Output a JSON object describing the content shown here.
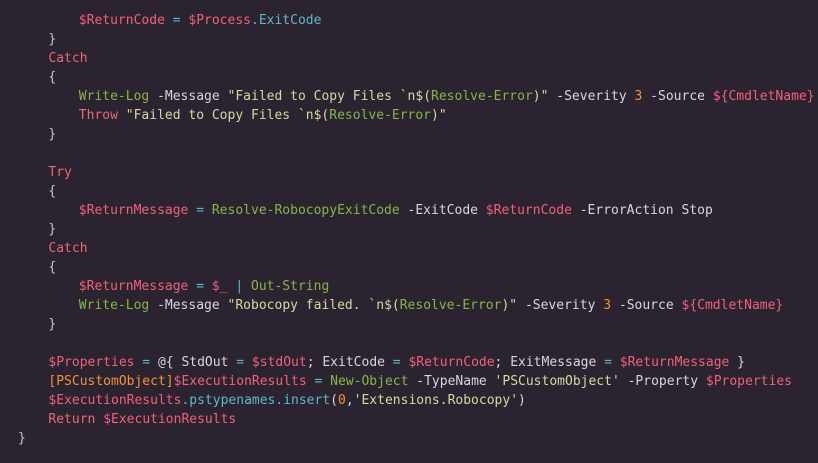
{
  "editor": {
    "language": "PowerShell",
    "colors": {
      "background": "#2b2430",
      "keyword": "#e86873",
      "variable": "#f0607a",
      "operator": "#5fb7c7",
      "command": "#86b44a",
      "string": "#d6d7a2",
      "number": "#f0933c",
      "text": "#d9d4dd"
    },
    "lines": [
      {
        "indent": 8,
        "tokens": [
          {
            "t": "var",
            "v": "$ReturnCode"
          },
          {
            "t": "op",
            "v": " = "
          },
          {
            "t": "var",
            "v": "$Process"
          },
          {
            "t": "prop",
            "v": ".ExitCode"
          }
        ]
      },
      {
        "indent": 4,
        "tokens": [
          {
            "t": "punc",
            "v": "}"
          }
        ]
      },
      {
        "indent": 4,
        "tokens": [
          {
            "t": "kw",
            "v": "Catch"
          }
        ]
      },
      {
        "indent": 4,
        "tokens": [
          {
            "t": "punc",
            "v": "{"
          }
        ]
      },
      {
        "indent": 8,
        "tokens": [
          {
            "t": "cmd",
            "v": "Write-Log"
          },
          {
            "t": "plain",
            "v": " -Message "
          },
          {
            "t": "str",
            "v": "\"Failed to Copy Files `n$("
          },
          {
            "t": "cmd",
            "v": "Resolve-Error"
          },
          {
            "t": "str",
            "v": ")\""
          },
          {
            "t": "plain",
            "v": " -Severity "
          },
          {
            "t": "num",
            "v": "3"
          },
          {
            "t": "plain",
            "v": " -Source "
          },
          {
            "t": "var",
            "v": "${CmdletName}"
          }
        ]
      },
      {
        "indent": 8,
        "tokens": [
          {
            "t": "kw",
            "v": "Throw"
          },
          {
            "t": "str",
            "v": " \"Failed to Copy Files `n$("
          },
          {
            "t": "cmd",
            "v": "Resolve-Error"
          },
          {
            "t": "str",
            "v": ")\""
          }
        ]
      },
      {
        "indent": 4,
        "tokens": [
          {
            "t": "punc",
            "v": "}"
          }
        ]
      },
      {
        "indent": 0,
        "tokens": []
      },
      {
        "indent": 4,
        "tokens": [
          {
            "t": "kw",
            "v": "Try"
          }
        ]
      },
      {
        "indent": 4,
        "tokens": [
          {
            "t": "punc",
            "v": "{"
          }
        ]
      },
      {
        "indent": 8,
        "tokens": [
          {
            "t": "var",
            "v": "$ReturnMessage"
          },
          {
            "t": "op",
            "v": " = "
          },
          {
            "t": "cmd",
            "v": "Resolve-RobocopyExitCode"
          },
          {
            "t": "plain",
            "v": " -ExitCode "
          },
          {
            "t": "var",
            "v": "$ReturnCode"
          },
          {
            "t": "plain",
            "v": " -ErrorAction Stop"
          }
        ]
      },
      {
        "indent": 4,
        "tokens": [
          {
            "t": "punc",
            "v": "}"
          }
        ]
      },
      {
        "indent": 4,
        "tokens": [
          {
            "t": "kw",
            "v": "Catch"
          }
        ]
      },
      {
        "indent": 4,
        "tokens": [
          {
            "t": "punc",
            "v": "{"
          }
        ]
      },
      {
        "indent": 8,
        "tokens": [
          {
            "t": "var",
            "v": "$ReturnMessage"
          },
          {
            "t": "op",
            "v": " = "
          },
          {
            "t": "var",
            "v": "$_"
          },
          {
            "t": "op",
            "v": " | "
          },
          {
            "t": "cmd",
            "v": "Out-String"
          }
        ]
      },
      {
        "indent": 8,
        "tokens": [
          {
            "t": "cmd",
            "v": "Write-Log"
          },
          {
            "t": "plain",
            "v": " -Message "
          },
          {
            "t": "str",
            "v": "\"Robocopy failed. `n$("
          },
          {
            "t": "cmd",
            "v": "Resolve-Error"
          },
          {
            "t": "str",
            "v": ")\""
          },
          {
            "t": "plain",
            "v": " -Severity "
          },
          {
            "t": "num",
            "v": "3"
          },
          {
            "t": "plain",
            "v": " -Source "
          },
          {
            "t": "var",
            "v": "${CmdletName}"
          }
        ]
      },
      {
        "indent": 4,
        "tokens": [
          {
            "t": "punc",
            "v": "}"
          }
        ]
      },
      {
        "indent": 0,
        "tokens": []
      },
      {
        "indent": 4,
        "tokens": [
          {
            "t": "var",
            "v": "$Properties"
          },
          {
            "t": "op",
            "v": " = "
          },
          {
            "t": "plain",
            "v": "@{ StdOut "
          },
          {
            "t": "op",
            "v": "= "
          },
          {
            "t": "var",
            "v": "$stdOut"
          },
          {
            "t": "plain",
            "v": "; ExitCode "
          },
          {
            "t": "op",
            "v": "= "
          },
          {
            "t": "var",
            "v": "$ReturnCode"
          },
          {
            "t": "plain",
            "v": "; ExitMessage "
          },
          {
            "t": "op",
            "v": "= "
          },
          {
            "t": "var",
            "v": "$ReturnMessage"
          },
          {
            "t": "plain",
            "v": " }"
          }
        ]
      },
      {
        "indent": 4,
        "tokens": [
          {
            "t": "type",
            "v": "[PSCustomObject]"
          },
          {
            "t": "var",
            "v": "$ExecutionResults"
          },
          {
            "t": "op",
            "v": " = "
          },
          {
            "t": "cmd",
            "v": "New-Object"
          },
          {
            "t": "plain",
            "v": " -TypeName "
          },
          {
            "t": "str",
            "v": "'PSCustomObject'"
          },
          {
            "t": "plain",
            "v": " -Property "
          },
          {
            "t": "var",
            "v": "$Properties"
          }
        ]
      },
      {
        "indent": 4,
        "tokens": [
          {
            "t": "var",
            "v": "$ExecutionResults"
          },
          {
            "t": "prop",
            "v": ".pstypenames.insert"
          },
          {
            "t": "plain",
            "v": "("
          },
          {
            "t": "num",
            "v": "0"
          },
          {
            "t": "plain",
            "v": ","
          },
          {
            "t": "str",
            "v": "'Extensions.Robocopy'"
          },
          {
            "t": "plain",
            "v": ")"
          }
        ]
      },
      {
        "indent": 4,
        "tokens": [
          {
            "t": "kw",
            "v": "Return "
          },
          {
            "t": "var",
            "v": "$ExecutionResults"
          }
        ]
      },
      {
        "indent": 0,
        "tokens": [
          {
            "t": "punc",
            "v": "}"
          }
        ]
      }
    ]
  }
}
